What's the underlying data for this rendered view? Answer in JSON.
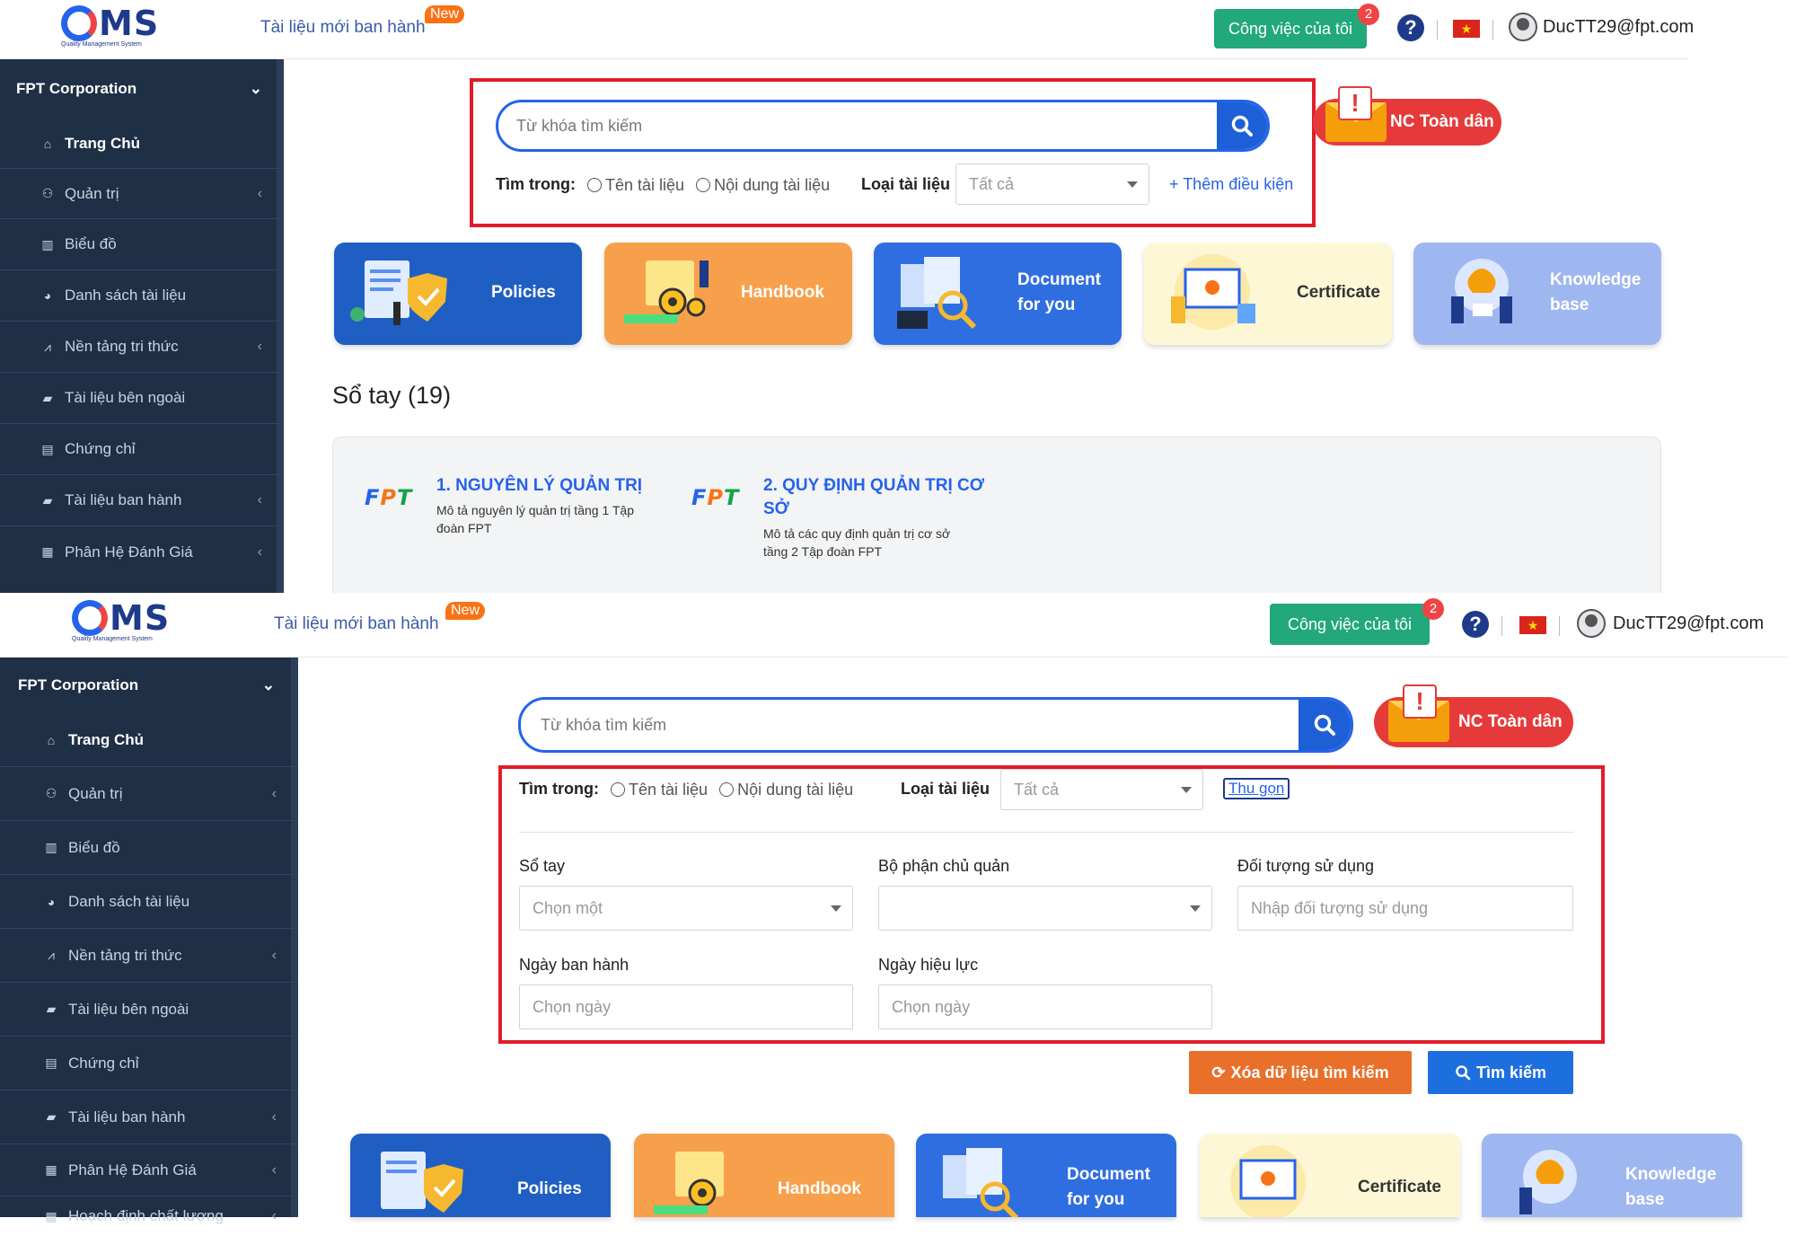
{
  "logo": {
    "text": "MS",
    "subtitle": "Quality Management System"
  },
  "header": {
    "new_docs": "Tài liệu mới ban hành",
    "new_badge": "New",
    "my_tasks": "Công việc của tôi",
    "task_count": "2",
    "help": "?",
    "flag_star": "★",
    "user": "DucTT29@fpt.com"
  },
  "sidebar": {
    "org": "FPT Corporation",
    "items": [
      {
        "label": "Trang Chủ",
        "icon": "home-icon"
      },
      {
        "label": "Quản trị",
        "icon": "users-icon"
      },
      {
        "label": "Biểu đồ",
        "icon": "bar-chart-icon"
      },
      {
        "label": "Danh sách tài liệu",
        "icon": "pie-chart-icon"
      },
      {
        "label": "Nền tảng tri thức",
        "icon": "line-chart-icon"
      },
      {
        "label": "Tài liệu bên ngoài",
        "icon": "book-icon"
      },
      {
        "label": "Chứng chỉ",
        "icon": "file-icon"
      },
      {
        "label": "Tài liệu ban hành",
        "icon": "book-icon"
      },
      {
        "label": "Phân Hệ Đánh Giá",
        "icon": "calendar-icon"
      },
      {
        "label": "Hoạch định chất lượng",
        "icon": "calendar-icon"
      }
    ]
  },
  "search": {
    "placeholder": "Từ khóa tìm kiếm",
    "in_label": "Tìm trong:",
    "opt_name": "Tên tài liệu",
    "opt_content": "Nội dung tài liệu",
    "type_label": "Loại tài liệu",
    "type_value": "Tất cả",
    "more": "+ Thêm điều kiện",
    "collapse": "Thu gọn"
  },
  "nc_button": "NC Toàn dân",
  "warn_mark": "!",
  "advanced": {
    "handbook_label": "Sổ tay",
    "handbook_ph": "Chọn một",
    "dept_label": "Bộ phận chủ quản",
    "audience_label": "Đối tượng sử dụng",
    "audience_ph": "Nhập đối tượng sử dụng",
    "issue_label": "Ngày ban hành",
    "issue_ph": "Chọn ngày",
    "effective_label": "Ngày hiệu lực",
    "effective_ph": "Chọn ngày",
    "clear_btn": "Xóa dữ liệu tìm kiếm",
    "search_btn": "Tìm kiếm"
  },
  "cards": [
    {
      "title": "Policies",
      "bg": "#1f5fc4",
      "color": "#ffffff"
    },
    {
      "title": "Handbook",
      "bg": "#f7a04b",
      "color": "#ffffff"
    },
    {
      "title": "Document for you",
      "bg": "#2f6ee0",
      "color": "#ffffff"
    },
    {
      "title": "Certificate",
      "bg": "#fdf7d6",
      "color": "#333333"
    },
    {
      "title": "Knowledge base",
      "bg": "#9fb7f0",
      "color": "#ffffff"
    }
  ],
  "handbook_section": {
    "title": "Sổ tay (19)",
    "books": [
      {
        "title": "1. NGUYÊN LÝ QUẢN TRỊ",
        "desc": "Mô tả nguyên lý quản trị tầng 1 Tập đoàn FPT"
      },
      {
        "title": "2. QUY ĐỊNH QUẢN TRỊ CƠ SỞ",
        "desc": "Mô tả các quy định quản trị cơ sở tầng 2 Tập đoàn FPT"
      }
    ]
  },
  "fpt_logo": {
    "f": "F",
    "p": "P",
    "t": "T"
  },
  "colors": {
    "sidebar": "#1f2f46",
    "accent": "#1d5fd6",
    "highlight": "#e11d2a",
    "green": "#22a87a"
  }
}
